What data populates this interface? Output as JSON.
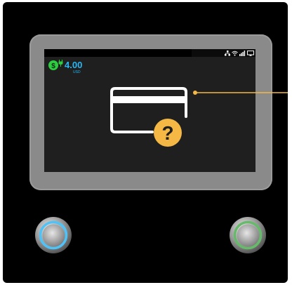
{
  "screen": {
    "balance": {
      "amount": "4.00",
      "currency": "USD"
    }
  },
  "icons": {
    "coin": "dollar-coin-icon",
    "plug": "plug-icon",
    "network": "network-icon",
    "wifi": "wifi-icon",
    "signal": "signal-icon",
    "display": "display-icon",
    "card": "credit-card-icon",
    "question": "question-mark-icon"
  },
  "buttons": {
    "left": {
      "ring_color": "#4fc3f7"
    },
    "right": {
      "ring_color": "#66bb6a"
    }
  },
  "colors": {
    "balance_text": "#29b6f6",
    "coin": "#2ecc40",
    "question_badge": "#f5b845",
    "callout_line": "#f5b845"
  }
}
